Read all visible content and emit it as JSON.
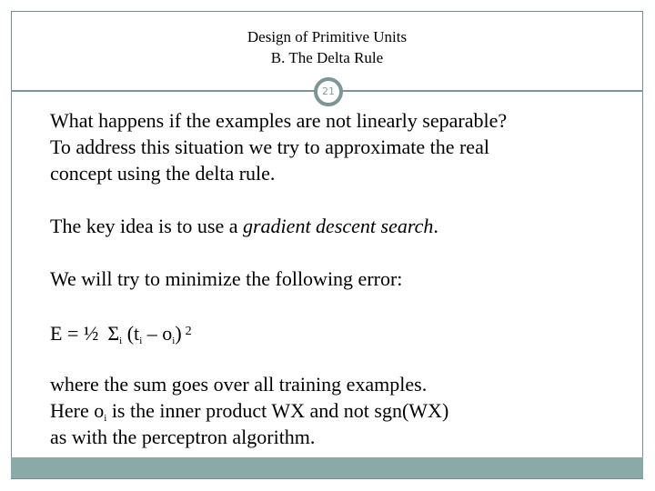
{
  "slide": {
    "title_line1": "Design of Primitive Units",
    "title_line2": "B. The Delta Rule",
    "page_number": "21"
  },
  "body": {
    "p1": [
      "What happens if the examples are not linearly separable?",
      "To address this situation we try to approximate the real",
      "concept using the delta rule."
    ],
    "p2_prefix": "The key idea is to use a ",
    "p2_italic": "gradient descent search",
    "p2_suffix": ".",
    "p3": "We will try to minimize the following error:",
    "formula": {
      "lhs": "E = ½",
      "sigma": "Σ",
      "sigma_sub": "i",
      "open": " (t",
      "t_sub": "i",
      "minus": " – o",
      "o_sub": "i",
      "close": ")",
      "exponent": "2"
    },
    "p4_line1": "where the sum goes over all training examples.",
    "p4_line2_prefix": "Here o",
    "p4_line2_sub": "i",
    "p4_line2_suffix": " is the inner product WX and not sgn(WX)",
    "p4_line3": "as with the perceptron algorithm."
  },
  "colors": {
    "accent": "#7d9595",
    "bottom_bar": "#8aaaa9"
  }
}
